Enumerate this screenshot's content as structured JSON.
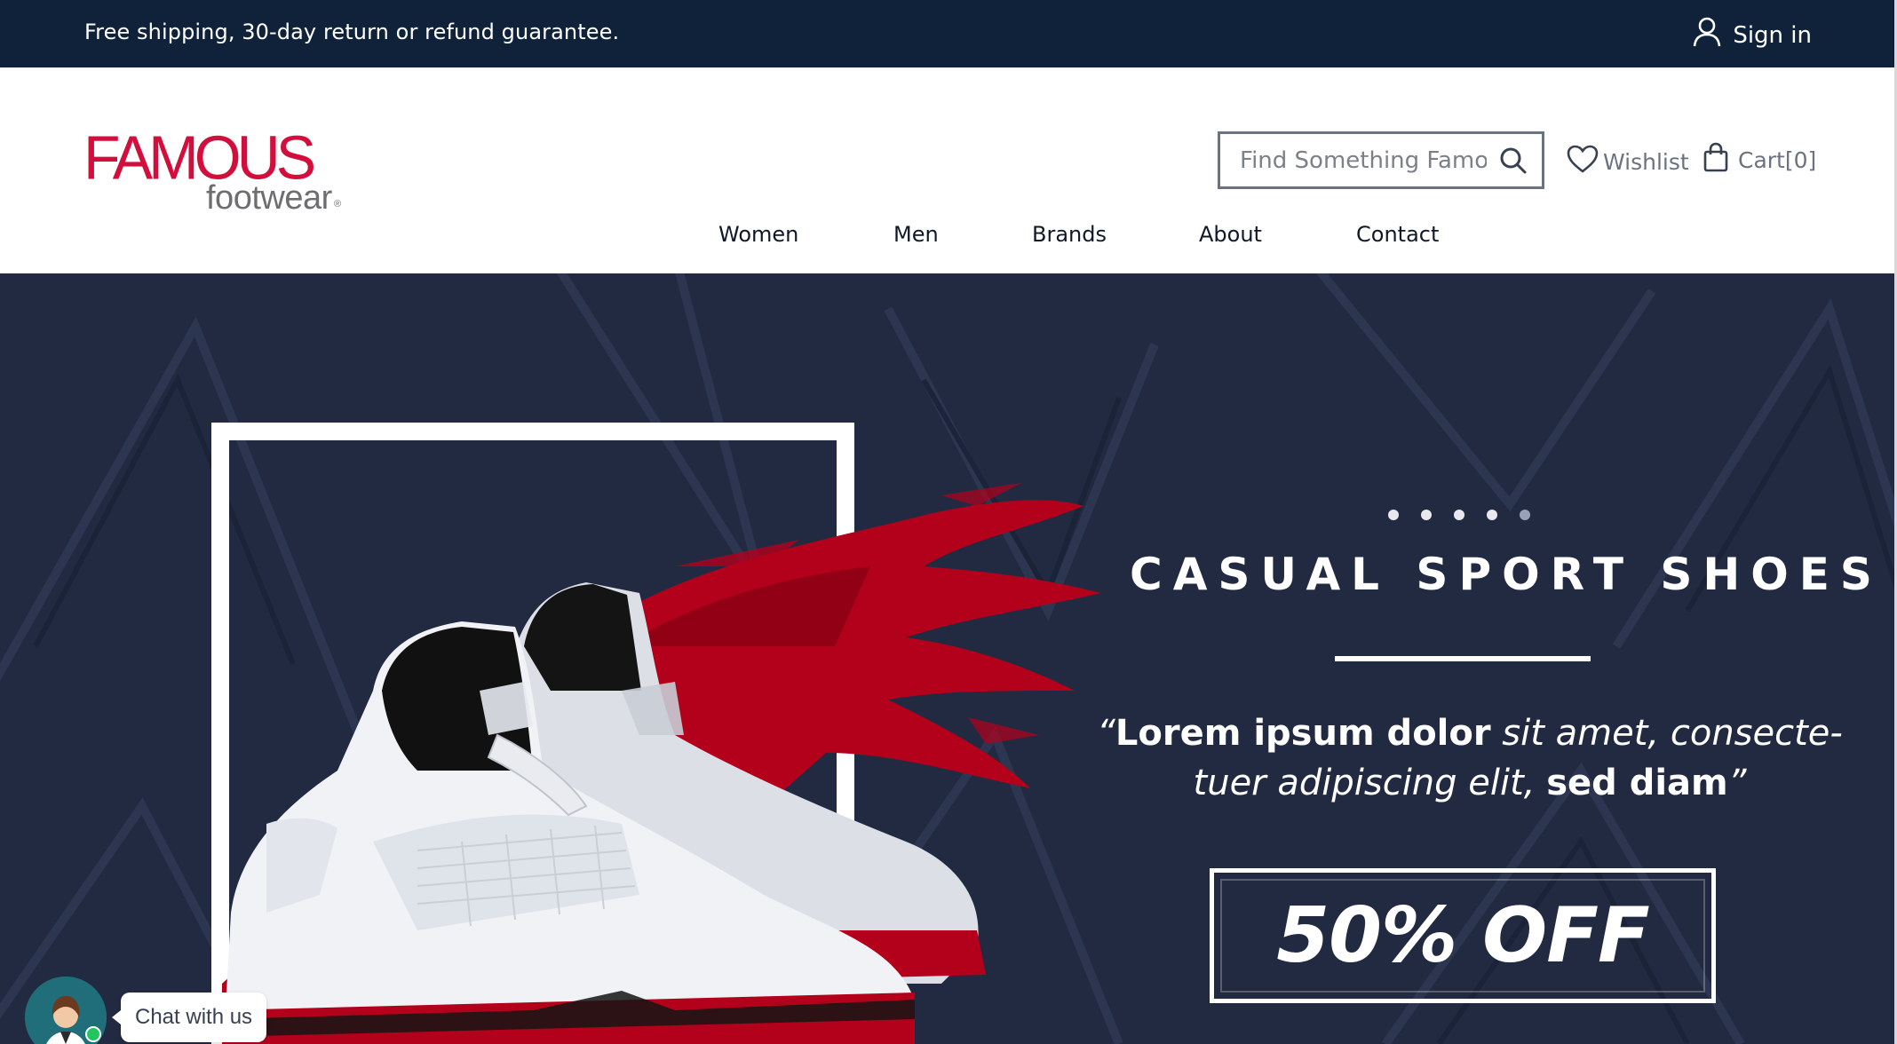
{
  "topbar": {
    "shipping_text": "Free shipping, 30-day return or refund guarantee.",
    "signin_label": "Sign in",
    "signin_icon": "user-icon"
  },
  "header": {
    "logo": {
      "primary": "FAMOUS",
      "secondary": "footwear",
      "mark": "®",
      "brand_color": "#d20f3c"
    },
    "search": {
      "placeholder": "Find Something Famous",
      "value": "",
      "icon": "search-icon"
    },
    "wishlist_label": "Wishlist",
    "cart_label": "Cart",
    "cart_count": "[0]"
  },
  "nav": {
    "items": [
      {
        "label": "Women"
      },
      {
        "label": "Men"
      },
      {
        "label": "Brands"
      },
      {
        "label": "About"
      },
      {
        "label": "Contact"
      }
    ]
  },
  "hero": {
    "title": "CASUAL SPORT SHOES",
    "quote_open": "“",
    "quote_bold_1": "Lorem ipsum dolor",
    "quote_italic_1": " sit amet, consecte-tuer adipiscing elit, ",
    "quote_bold_2": "sed diam",
    "quote_close": "”",
    "offer": "50% OFF",
    "slide_count": 5,
    "active_slide": 1,
    "background_color": "#222a42",
    "accent_color": "#b3001b"
  },
  "chat": {
    "label": "Chat with us",
    "status": "online"
  }
}
